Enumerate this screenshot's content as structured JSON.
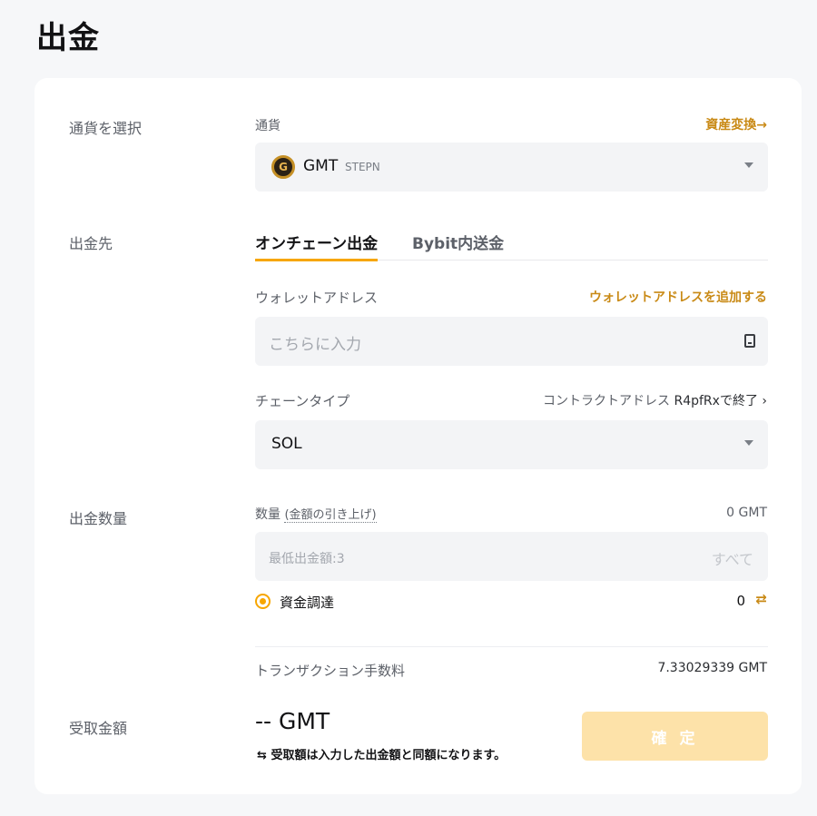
{
  "page": {
    "title": "出金"
  },
  "currency_section": {
    "label": "通貨を選択",
    "field_label": "通貨",
    "convert_link": "資産変換→",
    "selected": {
      "symbol": "GMT",
      "name": "STEPN",
      "icon": "gmt-coin-icon"
    }
  },
  "destination_section": {
    "label": "出金先",
    "tabs": [
      {
        "label": "オンチェーン出金",
        "active": true
      },
      {
        "label": "Bybit内送金",
        "active": false
      }
    ],
    "wallet_label": "ウォレットアドレス",
    "add_wallet_link": "ウォレットアドレスを追加する",
    "address_placeholder": "こちらに入力",
    "chain_label": "チェーンタイプ",
    "contract_text": "コントラクトアドレス",
    "contract_suffix": "R4pfRxで終了 ›",
    "chain_value": "SOL"
  },
  "amount_section": {
    "label": "出金数量",
    "field_label": "数量",
    "raise_link": "(金額の引き上げ)",
    "balance": "0 GMT",
    "min_placeholder": "最低出金額:3",
    "all_button": "すべて",
    "funding_label": "資金調達",
    "funding_value": "0",
    "fee_label": "トランザクション手数料",
    "fee_value": "7.33029339 GMT"
  },
  "receive_section": {
    "label": "受取金額",
    "amount": "-- GMT",
    "note_icon": "⇆",
    "note": "受取額は入力した出金額と同額になります。",
    "confirm_button": "確 定"
  },
  "colors": {
    "accent": "#f7a600",
    "link": "#c98a16",
    "button_disabled": "#fde2a9"
  }
}
